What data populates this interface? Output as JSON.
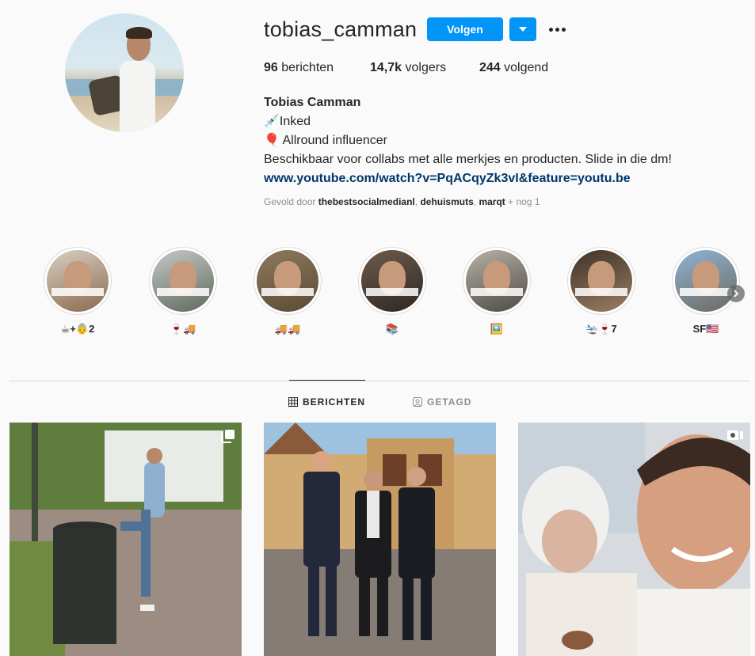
{
  "profile": {
    "username": "tobias_camman",
    "follow_label": "Volgen",
    "stats": {
      "posts_count": "96",
      "posts_label": "berichten",
      "followers_count": "14,7k",
      "followers_label": "volgers",
      "following_count": "244",
      "following_label": "volgend"
    },
    "bio": {
      "full_name": "Tobias Camman",
      "line1": "💉Inked",
      "line2": "🎈 Allround influencer",
      "line3": "Beschikbaar voor collabs met alle merkjes en producten. Slide in die dm!",
      "link": "www.youtube.com/watch?v=PqACqyZk3vI&feature=youtu.be"
    },
    "followed_by": {
      "prefix": "Gevold door",
      "account1": "thebestsocialmedianl",
      "account2": "dehuismuts",
      "account3": "marqt",
      "suffix": "+ nog 1"
    }
  },
  "highlights": [
    {
      "label": "☕+👵2"
    },
    {
      "label": "🍷🚚"
    },
    {
      "label": "🚚🚚"
    },
    {
      "label": "📚"
    },
    {
      "label": "🖼️"
    },
    {
      "label": "🛬🍷7"
    },
    {
      "label": "SF🇺🇸"
    }
  ],
  "tabs": {
    "posts": "BERICHTEN",
    "tagged": "GETAGD"
  },
  "colors": {
    "accent": "#0095f6",
    "link": "#00376b",
    "secondary_text": "#8e8e8e"
  }
}
